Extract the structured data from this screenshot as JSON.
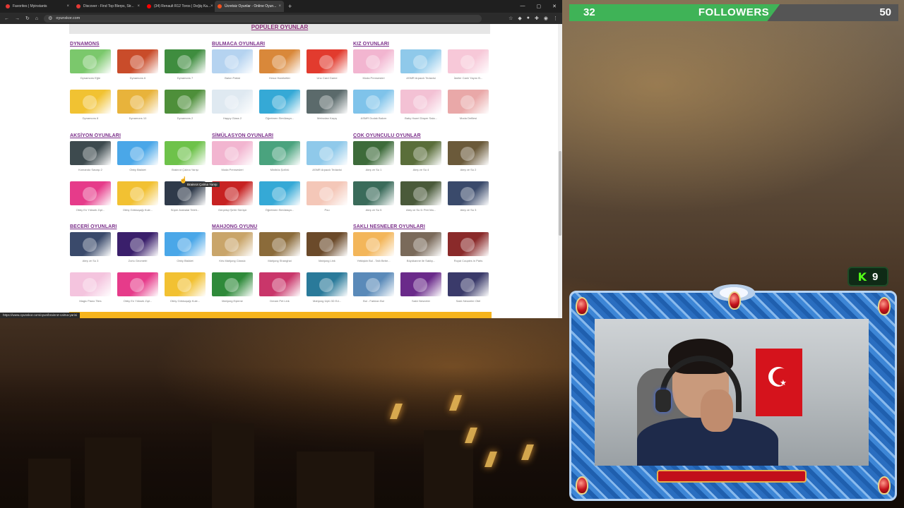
{
  "browser": {
    "tabs": [
      {
        "label": "Favorites | Myinstants",
        "color": "#e53935",
        "active": false
      },
      {
        "label": "Discover - Find Top Blerps, Str...",
        "color": "#e53935",
        "active": false
      },
      {
        "label": "(34) Renault R12 Toros | Değiş Ka...",
        "color": "#ff0000",
        "active": false
      },
      {
        "label": "Ücretsiz Oyunlar - Online Oyun...",
        "color": "#f4511e",
        "active": true
      }
    ],
    "new_tab": "+",
    "url": "oyunskor.com",
    "status_url": "https://www.oyunskor.com/oyun/brainrot-calma-yarisi",
    "tooltip": "Brainrot Çalma Yarışı"
  },
  "page": {
    "popular_header": "POPÜLER OYUNLAR",
    "categories": [
      {
        "title": "DYNAMONS",
        "games": [
          "Dynamons Eğle",
          "Dynamons 6",
          "Dynamons 7",
          "Dynamons 8",
          "Dynamons 10",
          "Dynamons 2"
        ],
        "colors": [
          "#7bc86c",
          "#c94c2a",
          "#3f8d3f",
          "#f1c232",
          "#e8b33b",
          "#4e8f3a"
        ]
      },
      {
        "title": "BULMACA OYUNLARI",
        "games": [
          "Balon Patlat",
          "Hırsız Hareketler",
          "Uno Card Game",
          "Happy Glass 2",
          "Öğretmen Simülasyo...",
          "Metrodan Kaçış"
        ],
        "colors": [
          "#b5d3f0",
          "#d9883a",
          "#e23b2e",
          "#dfe9f1",
          "#35a9d6",
          "#5b6a6b"
        ]
      },
      {
        "title": "KIZ OYUNLARI",
        "games": [
          "Moda Prensesleri",
          "ASMR Arpacık Tedavisi",
          "İdoller Canlı Yayını B...",
          "ASMR Dudak Bakım",
          "Baby Hazel Diaper Sala...",
          "Moda Defilesi"
        ],
        "colors": [
          "#f2b5d0",
          "#8fc9ea",
          "#f7c8d8",
          "#7fc3ea",
          "#f3c1d4",
          "#e9a8a8"
        ]
      },
      {
        "title": "AKSİYON OYUNLARI",
        "games": [
          "Komando Savaşı 2",
          "Obby Bisiklet",
          "Brainrot Çalma Yarışı",
          "Obby En Yüksek Zıpl...",
          "Obby Gökkuşağı Kule...",
          "Süper Arabalar Teleh..."
        ],
        "colors": [
          "#3d4a4e",
          "#4aa7e8",
          "#6ec24a",
          "#e63b8a",
          "#f2c132",
          "#2f3a4a"
        ]
      },
      {
        "title": "SİMÜLASYON OYUNLARI",
        "games": [
          "Moda Prensesleri",
          "Minibüs Şoförü",
          "ASMR Arpacık Tedavisi",
          "Gerçekçi Şehir Sürüşü",
          "Öğretmen Simülasyo...",
          "Pou"
        ],
        "colors": [
          "#f2b5d0",
          "#4aa37e",
          "#8fc9ea",
          "#c72222",
          "#35a9d6",
          "#f4c7b8"
        ]
      },
      {
        "title": "ÇOK OYUNCULU OYUNLAR",
        "games": [
          "Ateş ve Su 1",
          "Ateş ve Su 4",
          "Ateş ve Su 2",
          "Ateş ve Su 5",
          "Ateş ve Su 6: Peri Ma...",
          "Ateş ve Su 3"
        ],
        "colors": [
          "#3d6b3a",
          "#5a6e3a",
          "#6b5a3a",
          "#3a6b5a",
          "#4a5a3a",
          "#3a4a6b"
        ]
      },
      {
        "title": "BECERİ OYUNLARI",
        "games": [
          "Ateş ve Su 3",
          "Zorlu Geometri",
          "Obby Bisiklet",
          "Magic Piano Tiles",
          "Obby En Yüksek Zıpl...",
          "Obby Gökkuşağı Kule..."
        ],
        "colors": [
          "#3a4a6b",
          "#3a1f6b",
          "#4aa7e8",
          "#f4c4de",
          "#e63b8a",
          "#f2c132"
        ]
      },
      {
        "title": "MAHJONG OYUNU",
        "games": [
          "Kris Mahjong Classic",
          "Mahjong Shanghai",
          "Mahjong Link",
          "Mahjong Eşleme",
          "Dream Pet Link",
          "Mahjong Üçlü 3D Ed..."
        ],
        "colors": [
          "#c9a56a",
          "#8b6b3a",
          "#6b4a2a",
          "#2f8a3a",
          "#c9366a",
          "#2a7a9a"
        ]
      },
      {
        "title": "SAKLI NESNELER OYUNLARI",
        "games": [
          "Yetkişkin Bul - Tatlı Bebe...",
          "Büyükanne ile Saklıy...",
          "Royal Couples in Paris",
          "Bul - Farkları Bul",
          "Saklı Nesneler",
          "Saklı Nesneler Otel"
        ],
        "colors": [
          "#f3b65a",
          "#7a6a5a",
          "#8a2a2a",
          "#5a8ab9",
          "#6a2a8a",
          "#3a3a6a"
        ]
      }
    ]
  },
  "followers": {
    "current": "32",
    "label": "FOLLOWERS",
    "goal": "50",
    "progress": 0.64
  },
  "kick": {
    "icon": "K",
    "viewers": "9"
  },
  "colors": {
    "accent_purple": "#7b2f8a",
    "followers_green": "#3fb357",
    "kick_green": "#53fc18"
  }
}
